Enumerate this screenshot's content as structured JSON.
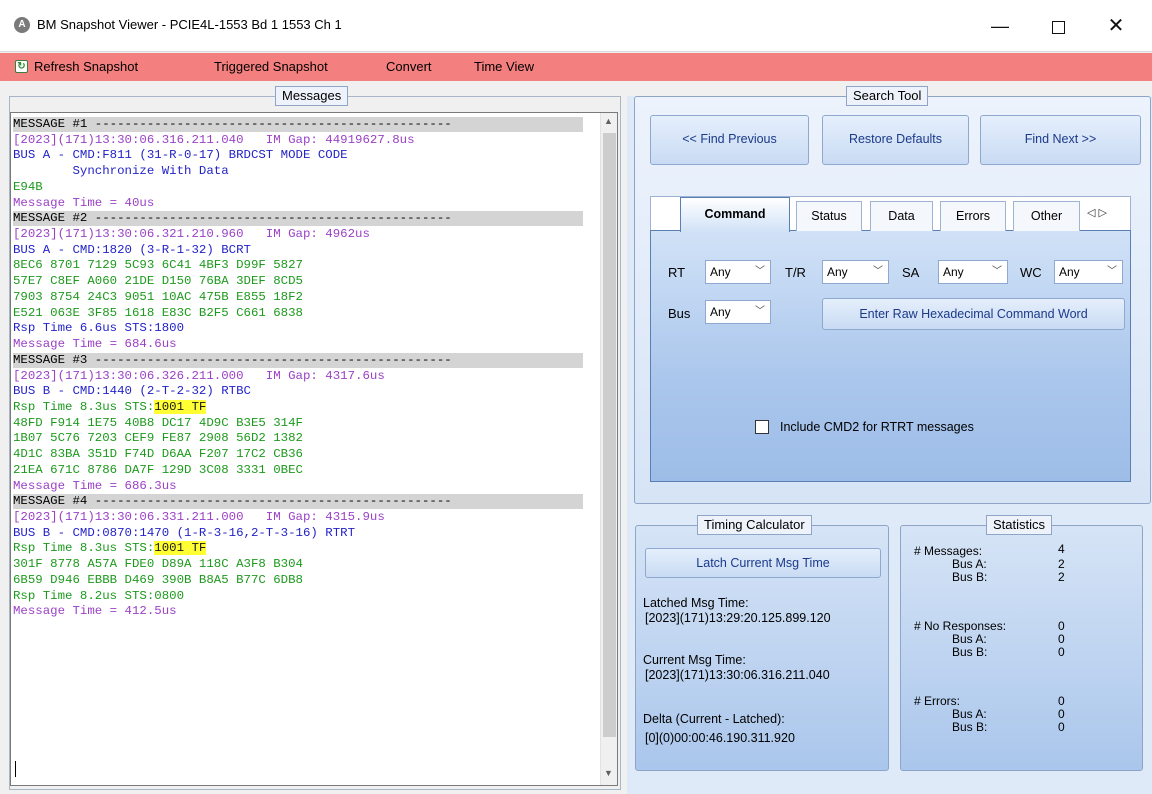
{
  "window": {
    "title": "BM Snapshot Viewer - PCIE4L-1553 Bd 1 1553 Ch 1",
    "app_icon": "A",
    "minimize": "—",
    "close": "✕"
  },
  "menu": {
    "refresh_snapshot": "Refresh Snapshot",
    "triggered_snapshot": "Triggered Snapshot",
    "convert": "Convert",
    "time_view": "Time View"
  },
  "messages": {
    "caption": "Messages",
    "lines": [
      {
        "text": "MESSAGE #1 ------------------------------------------------",
        "style": "hdr"
      },
      {
        "text": "[2023](171)13:30:06.316.211.040   IM Gap: 44919627.8us",
        "style": "time"
      },
      {
        "text": "BUS A - CMD:F811 (31-R-0-17) BRDCST MODE CODE",
        "style": "blue"
      },
      {
        "text": "        Synchronize With Data",
        "style": "blue"
      },
      {
        "text": "E94B",
        "style": "green"
      },
      {
        "text": "Message Time = 40us",
        "style": "purple"
      },
      {
        "text": "MESSAGE #2 ------------------------------------------------",
        "style": "hdr"
      },
      {
        "text": "[2023](171)13:30:06.321.210.960   IM Gap: 4962us",
        "style": "time"
      },
      {
        "text": "BUS A - CMD:1820 (3-R-1-32) BCRT",
        "style": "blue"
      },
      {
        "text": "8EC6 8701 7129 5C93 6C41 4BF3 D99F 5827",
        "style": "green"
      },
      {
        "text": "57E7 C8EF A060 21DE D150 76BA 3DEF 8CD5",
        "style": "green"
      },
      {
        "text": "7903 8754 24C3 9051 10AC 475B E855 18F2",
        "style": "green"
      },
      {
        "text": "E521 063E 3F85 1618 E83C B2F5 C661 6838",
        "style": "green"
      },
      {
        "text": "Rsp Time 6.6us STS:1800",
        "style": "blue"
      },
      {
        "text": "Message Time = 684.6us",
        "style": "purple"
      },
      {
        "text": "MESSAGE #3 ------------------------------------------------",
        "style": "hdr"
      },
      {
        "text": "[2023](171)13:30:06.326.211.000   IM Gap: 4317.6us",
        "style": "time"
      },
      {
        "text": "BUS B - CMD:1440 (2-T-2-32) RTBC",
        "style": "blue"
      },
      {
        "text": "Rsp Time 8.3us STS:",
        "style": "green",
        "highlight": "1001 TF"
      },
      {
        "text": "48FD F914 1E75 40B8 DC17 4D9C B3E5 314F",
        "style": "green"
      },
      {
        "text": "1B07 5C76 7203 CEF9 FE87 2908 56D2 1382",
        "style": "green"
      },
      {
        "text": "4D1C 83BA 351D F74D D6AA F207 17C2 CB36",
        "style": "green"
      },
      {
        "text": "21EA 671C 8786 DA7F 129D 3C08 3331 0BEC",
        "style": "green"
      },
      {
        "text": "Message Time = 686.3us",
        "style": "purple"
      },
      {
        "text": "MESSAGE #4 ------------------------------------------------",
        "style": "hdr"
      },
      {
        "text": "[2023](171)13:30:06.331.211.000   IM Gap: 4315.9us",
        "style": "time"
      },
      {
        "text": "BUS B - CMD:0870:1470 (1-R-3-16,2-T-3-16) RTRT",
        "style": "blue"
      },
      {
        "text": "Rsp Time 8.3us STS:",
        "style": "green",
        "highlight": "1001 TF"
      },
      {
        "text": "301F 8778 A57A FDE0 D89A 118C A3F8 B304",
        "style": "green"
      },
      {
        "text": "6B59 D946 EBBB D469 390B B8A5 B77C 6DB8",
        "style": "green"
      },
      {
        "text": "Rsp Time 8.2us STS:0800",
        "style": "green"
      },
      {
        "text": "Message Time = 412.5us",
        "style": "purple"
      }
    ]
  },
  "search": {
    "caption": "Search Tool",
    "find_previous": "<< Find Previous",
    "restore_defaults": "Restore Defaults",
    "find_next": "Find Next >>",
    "tabs": [
      "Command",
      "Status",
      "Data",
      "Errors",
      "Other"
    ],
    "tab_scroll": "◁ ▷",
    "rt_label": "RT",
    "tr_label": "T/R",
    "sa_label": "SA",
    "wc_label": "WC",
    "bus_label": "Bus",
    "rt_value": "Any",
    "tr_value": "Any",
    "sa_value": "Any",
    "wc_value": "Any",
    "bus_value": "Any",
    "raw_hex_button": "Enter Raw Hexadecimal Command Word",
    "include_cmd2": "Include CMD2 for RTRT messages"
  },
  "timing": {
    "caption": "Timing Calculator",
    "latch_button": "Latch Current Msg Time",
    "latched_label": "Latched Msg Time:",
    "latched_value": "[2023](171)13:29:20.125.899.120",
    "current_label": "Current Msg Time:",
    "current_value": "[2023](171)13:30:06.316.211.040",
    "delta_label": "Delta (Current - Latched):",
    "delta_value": "[0](0)00:00:46.190.311.920"
  },
  "statistics": {
    "caption": "Statistics",
    "messages_label": "# Messages:",
    "messages_value": "4",
    "messages_bus_a_label": "Bus A:",
    "messages_bus_a_value": "2",
    "messages_bus_b_label": "Bus B:",
    "messages_bus_b_value": "2",
    "no_responses_label": "# No Responses:",
    "no_responses_value": "0",
    "no_responses_bus_a_label": "Bus A:",
    "no_responses_bus_a_value": "0",
    "no_responses_bus_b_label": "Bus B:",
    "no_responses_bus_b_value": "0",
    "errors_label": "# Errors:",
    "errors_value": "0",
    "errors_bus_a_label": "Bus A:",
    "errors_bus_a_value": "0",
    "errors_bus_b_label": "Bus B:",
    "errors_bus_b_value": "0"
  },
  "colors": {
    "menubar": "#f47f7f",
    "timestamp": "#9b41c6",
    "bus_text": "#2323c9",
    "data_text": "#1d9a1d",
    "highlight": "#ffff33"
  }
}
